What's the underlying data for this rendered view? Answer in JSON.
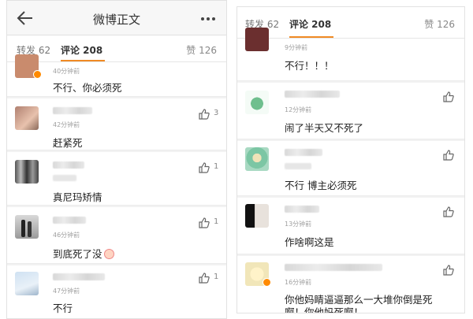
{
  "left": {
    "header": {
      "title": "微博正文"
    },
    "tabs": {
      "reposts": "转发 62",
      "comments": "评论 208",
      "likes": "赞 126"
    },
    "comments": [
      {
        "time": "40分钟前",
        "text": "不行、你必须死",
        "likes": ""
      },
      {
        "time": "42分钟前",
        "text": "赶紧死",
        "likes": "3"
      },
      {
        "time": "",
        "text": "真尼玛矫情",
        "likes": "1"
      },
      {
        "time": "46分钟前",
        "text": "到底死了没",
        "likes": "1"
      },
      {
        "time": "47分钟前",
        "text": "不行",
        "likes": "1"
      }
    ]
  },
  "right": {
    "tabs": {
      "reposts": "转发 62",
      "comments": "评论 208",
      "likes": "赞 126"
    },
    "comments": [
      {
        "time": "9分钟前",
        "text": "不行！！！"
      },
      {
        "time": "12分钟前",
        "text": "闹了半天又不死了"
      },
      {
        "time": "12分钟前",
        "text": "不行 博主必须死"
      },
      {
        "time": "13分钟前",
        "text": "作啥啊这是"
      },
      {
        "time": "16分钟前",
        "text": "你他妈睛逼逼那么一大堆你倒是死",
        "text2": "啊！你他妈死啊！"
      }
    ]
  }
}
